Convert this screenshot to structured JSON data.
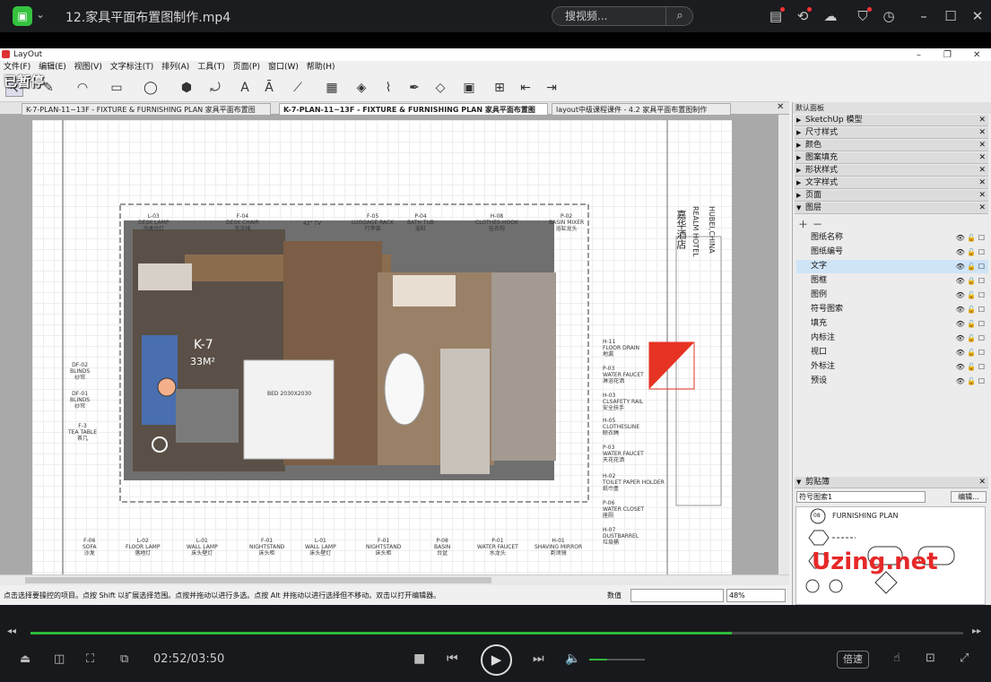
{
  "player": {
    "title": "12.家具平面布置图制作.mp4",
    "search_placeholder": "搜视频...",
    "time": "02:52/03:50",
    "progress": 0.752,
    "volume": 0.32,
    "speed_label": "倍速",
    "paused_label": "已暂停"
  },
  "app": {
    "title": "LayOut",
    "menu": [
      "文件(F)",
      "编辑(E)",
      "视图(V)",
      "文字标注(T)",
      "排列(A)",
      "工具(T)",
      "页面(P)",
      "窗口(W)",
      "帮助(H)"
    ],
    "tabs": [
      "K-7-PLAN-11~13F - FIXTURE & FURNISHING PLAN 家具平面布置图",
      "K-7-PLAN-11~13F - FIXTURE & FURNISHING PLAN 家具平面布置图",
      "layout中级课程课件 - 4.2 家具平面布置图制作"
    ],
    "status_text": "点击选择要操控的项目。点按 Shift 以扩展选择范围。点按并拖动以进行多选。点按 Alt 并拖动以进行选择但不移动。双击以打开编辑器。",
    "status_label": "数值",
    "zoom": "48%"
  },
  "panel": {
    "title": "默认面板",
    "sections": [
      "SketchUp 模型",
      "尺寸样式",
      "颜色",
      "图案填充",
      "形状样式",
      "文字样式",
      "页面",
      "图层"
    ],
    "layers": [
      "图纸名称",
      "图纸编号",
      "文字",
      "图框",
      "图例",
      "符号图索",
      "填充",
      "内标注",
      "视口",
      "外标注",
      "预设"
    ],
    "selected_layer": "文字",
    "clip_title": "剪贴簿",
    "clip_select": "符号图索1",
    "clip_edit": "编辑..."
  },
  "drawing": {
    "hotel_cn": "嘉华酒店",
    "hotel_en": "REALM HOTEL",
    "hotel_loc": "HUBEI,CHINA",
    "room": "K-7",
    "area": "33M²",
    "bed": "BED 2030X2030",
    "clip_label": "FURNISHING PLAN",
    "clip_number": "08",
    "top_labels": [
      {
        "code": "L-03",
        "en": "DESK LAMP",
        "cn": "书桌台灯"
      },
      {
        "code": "F-04",
        "en": "DESK CHAIR",
        "cn": "写字椅"
      },
      {
        "code": "42\" TV",
        "en": "",
        "cn": ""
      },
      {
        "code": "F-05",
        "en": "LUGGAGE RACK",
        "cn": "行李架"
      },
      {
        "code": "P-04",
        "en": "BATH TUB",
        "cn": "浴缸"
      },
      {
        "code": "H-08",
        "en": "CLOTHES-HOOK",
        "cn": "挂衣钩"
      },
      {
        "code": "P-02",
        "en": "BASIN MIXER",
        "cn": "浴缸龙头"
      }
    ],
    "bottom_labels": [
      {
        "code": "F-06",
        "en": "SOFA",
        "cn": "沙发"
      },
      {
        "code": "L-02",
        "en": "FLOOR LAMP",
        "cn": "落地灯"
      },
      {
        "code": "L-01",
        "en": "WALL LAMP",
        "cn": "床头壁灯"
      },
      {
        "code": "F-01",
        "en": "NIGHTSTAND",
        "cn": "床头柜"
      },
      {
        "code": "L-01",
        "en": "WALL LAMP",
        "cn": "床头壁灯"
      },
      {
        "code": "F-01",
        "en": "NIGHTSTAND",
        "cn": "床头柜"
      },
      {
        "code": "P-08",
        "en": "BASIN",
        "cn": "台盆"
      },
      {
        "code": "P-01",
        "en": "WATER FAUCET",
        "cn": "水龙头"
      },
      {
        "code": "H-01",
        "en": "SHAVING MIRROR",
        "cn": "剃须镜"
      }
    ],
    "right_labels": [
      {
        "code": "H-11",
        "en": "FLOOR DRAIN",
        "cn": "地漏"
      },
      {
        "code": "P-03",
        "en": "WATER FAUCET",
        "cn": "淋浴花洒"
      },
      {
        "code": "H-03",
        "en": "CLSAFETY RAIL",
        "cn": "安全扶手"
      },
      {
        "code": "H-05",
        "en": "CLOTHESLINE",
        "cn": "晾衣绳"
      },
      {
        "code": "P-03",
        "en": "WATER FAUCET",
        "cn": "天花花洒"
      },
      {
        "code": "H-02",
        "en": "TOILET PAPER HOLDER",
        "cn": "纸巾盒"
      },
      {
        "code": "P-06",
        "en": "WATER CLOSET",
        "cn": "座厕"
      },
      {
        "code": "H-07",
        "en": "DUSTBARREL",
        "cn": "垃圾桶"
      }
    ],
    "left_labels": [
      {
        "code": "DF-02",
        "en": "BLINDS",
        "cn": "纱帘"
      },
      {
        "code": "DF-01",
        "en": "BLINDS",
        "cn": "纱帘"
      },
      {
        "code": "F-3",
        "en": "TEA TABLE",
        "cn": "茶几"
      }
    ]
  },
  "watermark": "Uzing.net"
}
